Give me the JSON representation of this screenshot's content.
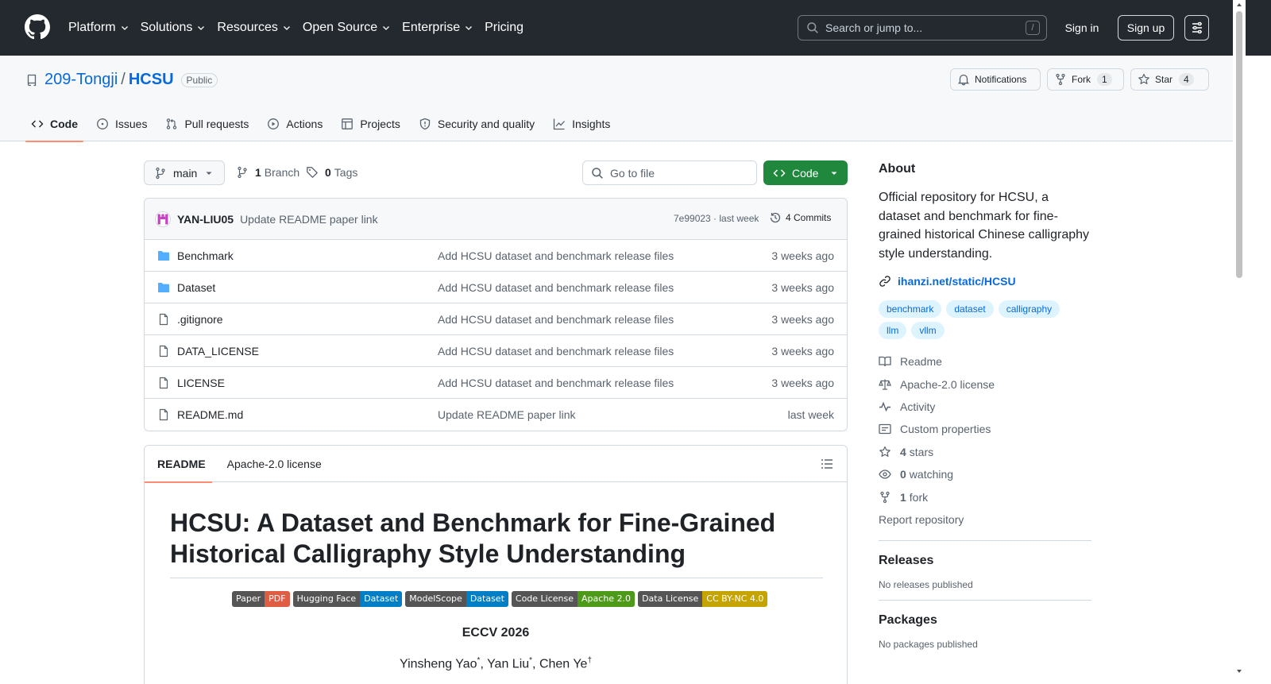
{
  "header": {
    "nav": [
      "Platform",
      "Solutions",
      "Resources",
      "Open Source",
      "Enterprise",
      "Pricing"
    ],
    "search_placeholder": "Search or jump to...",
    "search_key": "/",
    "signin": "Sign in",
    "signup": "Sign up"
  },
  "repo": {
    "owner": "209-Tongji",
    "sep": "/",
    "name": "HCSU",
    "visibility": "Public",
    "notifications": "Notifications",
    "fork_label": "Fork",
    "fork_count": "1",
    "star_label": "Star",
    "star_count": "4",
    "tabs": [
      "Code",
      "Issues",
      "Pull requests",
      "Actions",
      "Projects",
      "Security and quality",
      "Insights"
    ]
  },
  "toolbar": {
    "branch": "main",
    "branch_count": "1",
    "branch_label": "Branch",
    "tag_count": "0",
    "tag_label": "Tags",
    "goto_placeholder": "Go to file",
    "code_label": "Code"
  },
  "commit": {
    "author": "YAN-LIU05",
    "message": "Update README paper link",
    "meta": "7e99023 · last week",
    "history": "4 Commits"
  },
  "files": [
    {
      "name": "Benchmark",
      "type": "folder",
      "message": "Add HCSU dataset and benchmark release files",
      "age": "3 weeks ago"
    },
    {
      "name": "Dataset",
      "type": "folder",
      "message": "Add HCSU dataset and benchmark release files",
      "age": "3 weeks ago"
    },
    {
      "name": ".gitignore",
      "type": "file",
      "message": "Add HCSU dataset and benchmark release files",
      "age": "3 weeks ago"
    },
    {
      "name": "DATA_LICENSE",
      "type": "file",
      "message": "Add HCSU dataset and benchmark release files",
      "age": "3 weeks ago"
    },
    {
      "name": "LICENSE",
      "type": "file",
      "message": "Add HCSU dataset and benchmark release files",
      "age": "3 weeks ago"
    },
    {
      "name": "README.md",
      "type": "file",
      "message": "Update README paper link",
      "age": "last week"
    }
  ],
  "readme": {
    "tabs": [
      "README",
      "Apache-2.0 license"
    ],
    "title": "HCSU: A Dataset and Benchmark for Fine-Grained Historical Calligraphy Style Understanding",
    "shields": [
      {
        "left": "Paper",
        "right": "PDF",
        "color": "#e05d44"
      },
      {
        "left": "Hugging Face",
        "right": "Dataset",
        "color": "#007ec6"
      },
      {
        "left": "ModelScope",
        "right": "Dataset",
        "color": "#007ec6"
      },
      {
        "left": "Code License",
        "right": "Apache 2.0",
        "color": "#4c9a17"
      },
      {
        "left": "Data License",
        "right": "CC BY-NC 4.0",
        "color": "#c5a400"
      }
    ],
    "venue": "ECCV 2026",
    "authors": [
      {
        "name": "Yinsheng Yao",
        "mark": "*"
      },
      {
        "name": "Yan Liu",
        "mark": "*"
      },
      {
        "name": "Chen Ye",
        "mark": "†"
      }
    ],
    "author_sep": ", "
  },
  "sidebar": {
    "about_title": "About",
    "about_text": "Official repository for HCSU, a dataset and benchmark for fine-grained historical Chinese calligraphy style understanding.",
    "website": "ihanzi.net/static/HCSU",
    "topics": [
      "benchmark",
      "dataset",
      "calligraphy",
      "llm",
      "vllm"
    ],
    "items": [
      {
        "icon": "book-icon",
        "bold": "",
        "label": "Readme"
      },
      {
        "icon": "law-icon",
        "bold": "",
        "label": "Apache-2.0 license"
      },
      {
        "icon": "pulse-icon",
        "bold": "",
        "label": "Activity"
      },
      {
        "icon": "note-icon",
        "bold": "",
        "label": "Custom properties"
      },
      {
        "icon": "star-icon",
        "bold": "4",
        "label": "stars"
      },
      {
        "icon": "eye-icon",
        "bold": "0",
        "label": "watching"
      },
      {
        "icon": "fork-icon",
        "bold": "1",
        "label": "fork"
      }
    ],
    "report": "Report repository",
    "releases_title": "Releases",
    "releases_text": "No releases published",
    "packages_title": "Packages",
    "packages_text": "No packages published"
  },
  "colors": {
    "header_bg": "#24292f",
    "link": "#0969da",
    "primary_button": "#1f883d",
    "tab_underline": "#fd8c73"
  }
}
